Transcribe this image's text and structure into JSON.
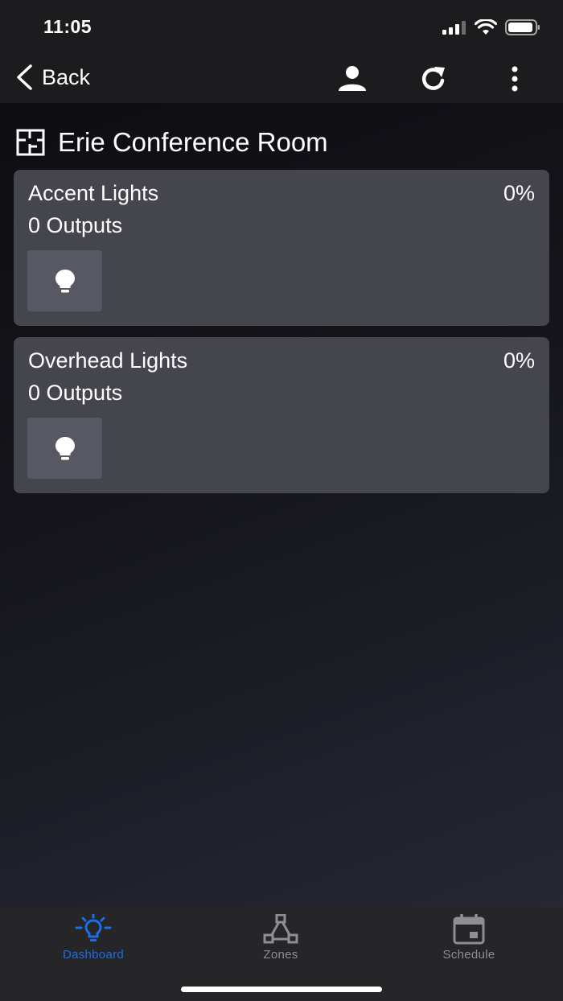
{
  "status_bar": {
    "time": "11:05"
  },
  "nav": {
    "back_label": "Back",
    "icons": [
      "person-icon",
      "refresh-icon",
      "more-vertical-icon"
    ]
  },
  "room": {
    "title": "Erie Conference Room",
    "icon": "floor-plan-icon"
  },
  "zones": [
    {
      "name": "Accent Lights",
      "level": "0%",
      "outputs": "0 Outputs",
      "icon": "lightbulb-icon"
    },
    {
      "name": "Overhead Lights",
      "level": "0%",
      "outputs": "0 Outputs",
      "icon": "lightbulb-icon"
    }
  ],
  "tabs": [
    {
      "label": "Dashboard",
      "icon": "lightbulb-rays-icon",
      "active": true
    },
    {
      "label": "Zones",
      "icon": "triangle-nodes-icon",
      "active": false
    },
    {
      "label": "Schedule",
      "icon": "calendar-icon",
      "active": false
    }
  ],
  "colors": {
    "accent": "#1a6ee8",
    "inactive_tab": "#8e8e93",
    "card": "#45454e",
    "bar": "#1c1c1e"
  }
}
